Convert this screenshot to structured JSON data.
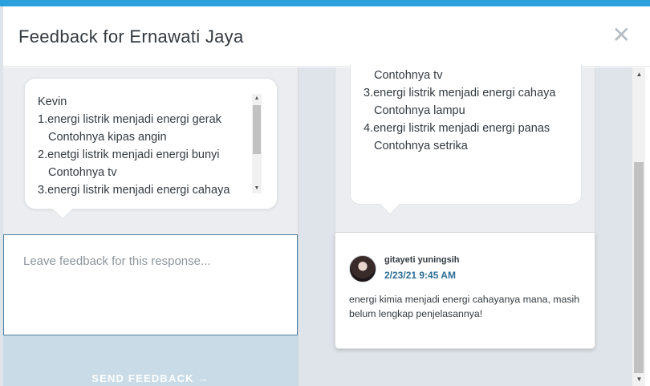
{
  "modal": {
    "title": "Feedback for Ernawati Jaya",
    "close_icon": "close-icon",
    "close_glyph": "✕"
  },
  "response_bubble": {
    "lines": [
      "Kevin",
      "1.energi listrik menjadi energi gerak",
      "Contohnya kipas angin",
      "2.enetgi listrik menjadi energi bunyi",
      "Contohnya tv",
      "3.energi listrik menjadi energi cahaya"
    ]
  },
  "feedback": {
    "placeholder": "Leave feedback for this response...",
    "send_label": "SEND FEEDBACK",
    "send_icon": "arrow-right-icon",
    "send_arrow": "→"
  },
  "right_bubble": {
    "lines": [
      "Contohnya tv",
      "3.energi listrik menjadi energi cahaya",
      "Contohnya lampu",
      "4.energi listrik menjadi energi panas",
      "Contohnya setrika"
    ]
  },
  "comment": {
    "author": "gitayeti yuningsih",
    "timestamp": "2/23/21 9:45 AM",
    "text": "energi kimia menjadi energi cahayanya mana, masih belum lengkap penjelasannya!"
  },
  "colors": {
    "accent": "#2aa1dc",
    "send_button_bg": "#c8dbe7",
    "timestamp": "#2c6d96"
  }
}
